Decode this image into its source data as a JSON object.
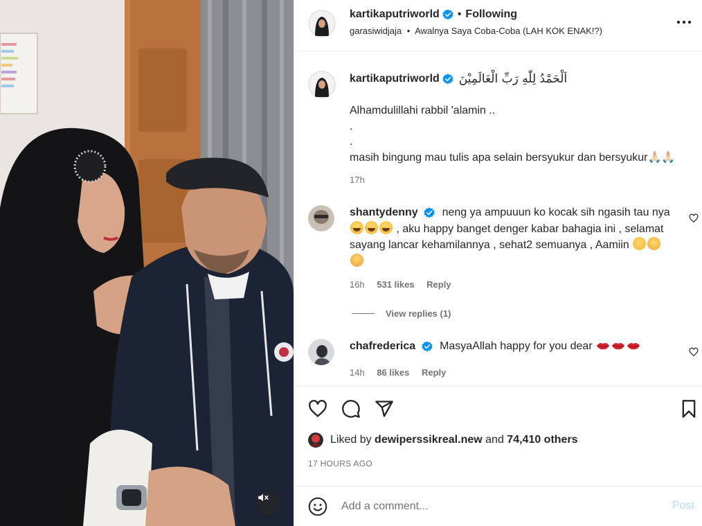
{
  "post": {
    "username": "kartikaputriworld",
    "following_label": "Following",
    "separator": "•",
    "audio_user": "garasiwidjaja",
    "audio_title": "Awalnya Saya Coba-Coba (LAH KOK ENAK!?)",
    "more_icon": "more-horizontal-icon"
  },
  "caption": {
    "username": "kartikaputriworld",
    "arabic": "اَلْحَمْدُ لِلّٰهِ رَبِّ الْعَالَمِيْنَ",
    "line1": "Alhamdulillahi rabbil 'alamin ..",
    "line2": ".",
    "line3": ".",
    "line4": "masih bingung mau tulis apa selain bersyukur dan bersyukur🙏🏻🙏🏻",
    "time": "17h"
  },
  "comments": [
    {
      "username": "shantydenny",
      "text_a": "neng ya ampuuun ko kocak sih ngasih tau nya",
      "text_b": ", aku happy banget denger kabar bahagia ini , selamat sayang lancar kehamilannya , sehat2 semuanya , Aamiin",
      "time": "16h",
      "likes": "531 likes",
      "reply": "Reply",
      "view_replies": "View replies (1)"
    },
    {
      "username": "chafrederica",
      "text": "MasyaAllah happy for you dear",
      "time": "14h",
      "likes": "86 likes",
      "reply": "Reply"
    }
  ],
  "likes": {
    "prefix": "Liked by",
    "user": "dewiperssikreal.new",
    "and": "and",
    "count": "74,410 others"
  },
  "timeago": "17 HOURS AGO",
  "add_comment": {
    "placeholder": "Add a comment...",
    "post_label": "Post"
  },
  "colors": {
    "verified": "#0095f6",
    "post_disabled": "#b2dffc",
    "muted_text": "#737373"
  }
}
